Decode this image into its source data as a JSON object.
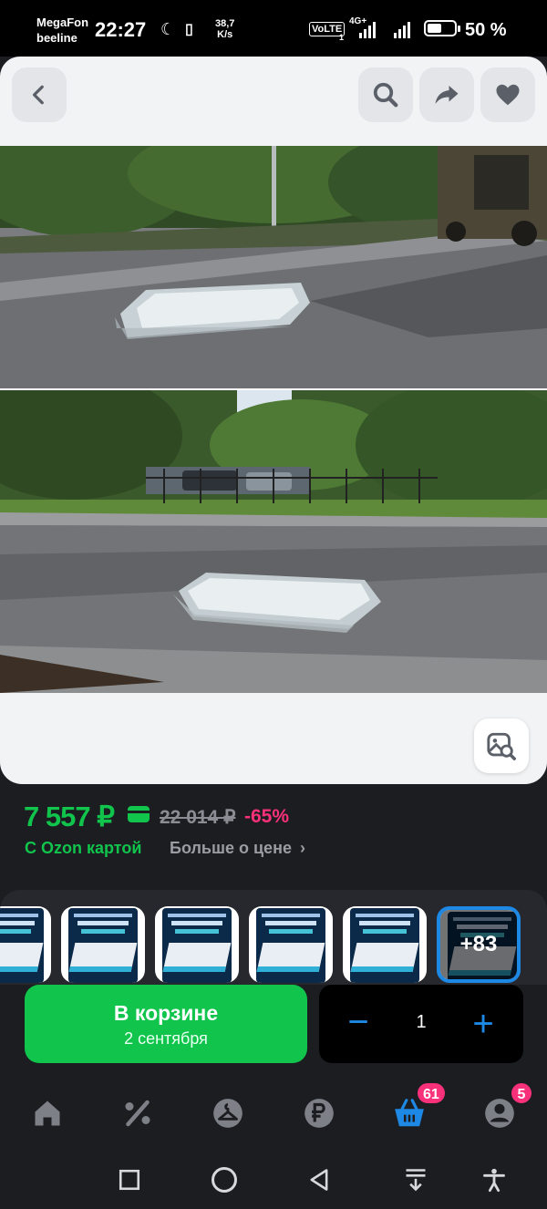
{
  "status_bar": {
    "carrier1": "MegaFon",
    "carrier2": "beeline",
    "time": "22:27",
    "speed_value": "38,7",
    "speed_unit": "K/s",
    "volte": "VoLTE",
    "volte_sub": "1",
    "network": "4G+",
    "battery": "50 %"
  },
  "header": {
    "back_icon": "chevron-left-icon",
    "search_icon": "search-icon",
    "share_icon": "share-icon",
    "favorite_icon": "heart-icon"
  },
  "price": {
    "current": "7 557 ₽",
    "old": "22 014 ₽",
    "discount": "-65%",
    "ozon_card_label": "С Ozon картой",
    "more_label": "Больше о цене",
    "accent_color": "#10c44c",
    "discount_color": "#f9307a"
  },
  "variants": {
    "more_count": "+83",
    "pkg_title": "Беспружинный матрас",
    "pkg_subtitle": "ортопедический"
  },
  "cart": {
    "title": "В корзине",
    "date": "2 сентября",
    "minus": "−",
    "quantity": "1",
    "plus": "+"
  },
  "bottom_nav": {
    "items": [
      "home-icon",
      "discount-icon",
      "catalog-icon",
      "ruble-icon",
      "cart-icon",
      "profile-icon"
    ],
    "cart_badge": "61",
    "profile_badge": "5",
    "active_color": "#1e88e5"
  }
}
